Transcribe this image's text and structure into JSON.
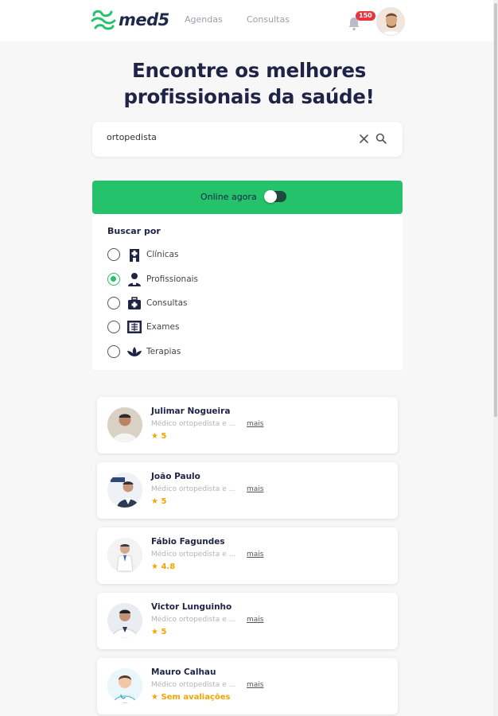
{
  "header": {
    "logo_text": "med5",
    "nav": [
      "Agendas",
      "Consultas"
    ],
    "notification_count": "150"
  },
  "hero": {
    "title_line1": "Encontre os melhores",
    "title_line2": "profissionais da saúde!"
  },
  "search": {
    "value": "ortopedista"
  },
  "online": {
    "label": "Online agora",
    "enabled": false
  },
  "filter": {
    "title": "Buscar por",
    "options": [
      {
        "label": "Clínicas",
        "icon": "hospital-building-icon",
        "selected": false
      },
      {
        "label": "Profissionais",
        "icon": "doctor-icon",
        "selected": true
      },
      {
        "label": "Consultas",
        "icon": "medical-kit-icon",
        "selected": false
      },
      {
        "label": "Exames",
        "icon": "xray-icon",
        "selected": false
      },
      {
        "label": "Terapias",
        "icon": "lotus-icon",
        "selected": false
      }
    ]
  },
  "results": [
    {
      "name": "Julimar Nogueira",
      "desc": "Médico ortopedista e ...",
      "more": "mais",
      "rating": "★ 5"
    },
    {
      "name": "João Paulo",
      "desc": "Médico ortopedista e ...",
      "more": "mais",
      "rating": "★ 5"
    },
    {
      "name": "Fábio Fagundes",
      "desc": "Médico ortopedista e ...",
      "more": "mais",
      "rating": "★ 4.8"
    },
    {
      "name": "Victor Lunguinho",
      "desc": "Médico ortopedista e ...",
      "more": "mais",
      "rating": "★ 5"
    },
    {
      "name": "Mauro Calhau",
      "desc": "Médico ortopedista e ...",
      "more": "mais",
      "rating": "★ Sem avaliações"
    }
  ],
  "colors": {
    "brand_green": "#24c26a",
    "navy": "#1f2346",
    "star": "#f0a500",
    "badge": "#e8343c"
  }
}
